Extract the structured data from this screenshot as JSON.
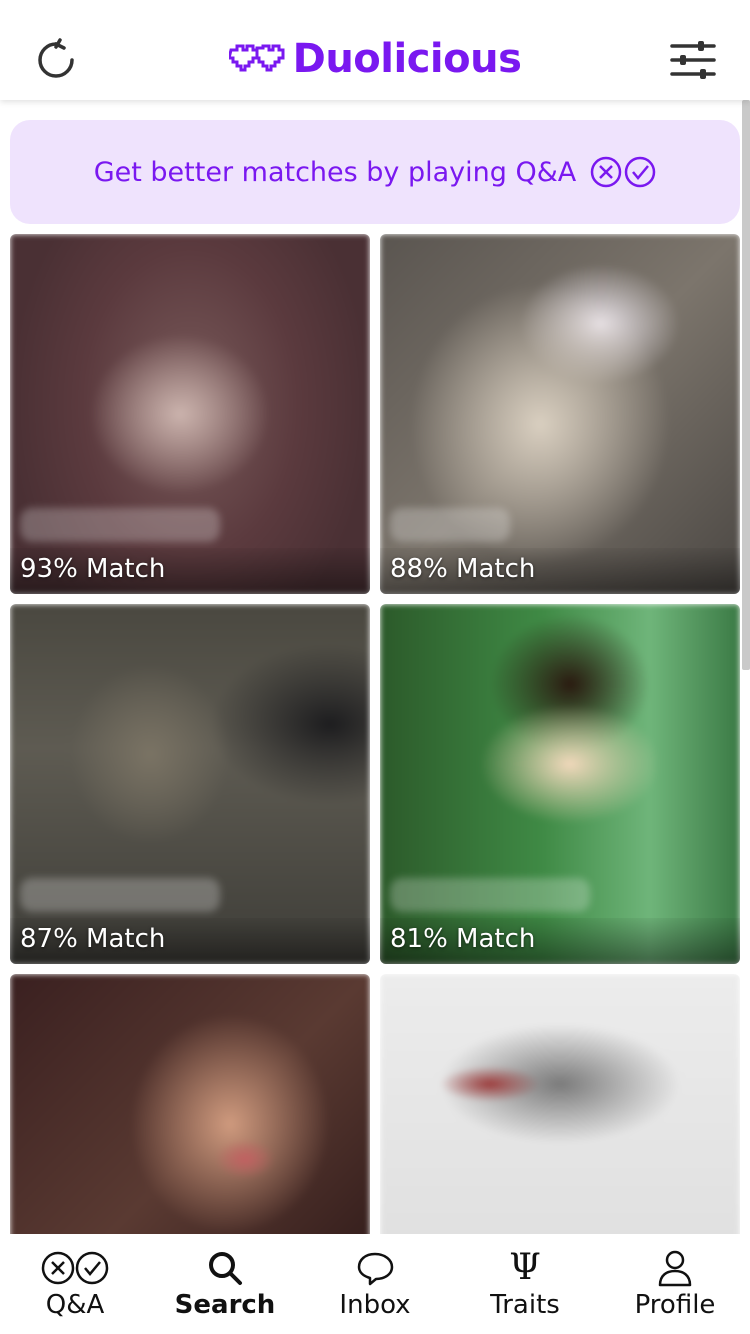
{
  "header": {
    "brand": "Duolicious",
    "refresh_icon": "refresh-icon",
    "filter_icon": "sliders-icon",
    "accent": "#7a18f0"
  },
  "banner": {
    "text": "Get better matches by playing Q&A",
    "background": "#efe3fd"
  },
  "cards": [
    {
      "match": "93% Match"
    },
    {
      "match": "88% Match"
    },
    {
      "match": "87% Match"
    },
    {
      "match": "81% Match"
    },
    {
      "match": ""
    },
    {
      "match": ""
    }
  ],
  "nav": [
    {
      "label": "Q&A",
      "icon": "qa-icon",
      "active": false
    },
    {
      "label": "Search",
      "icon": "search-icon",
      "active": true
    },
    {
      "label": "Inbox",
      "icon": "chat-icon",
      "active": false
    },
    {
      "label": "Traits",
      "icon": "psi-icon",
      "active": false
    },
    {
      "label": "Profile",
      "icon": "person-icon",
      "active": false
    }
  ]
}
